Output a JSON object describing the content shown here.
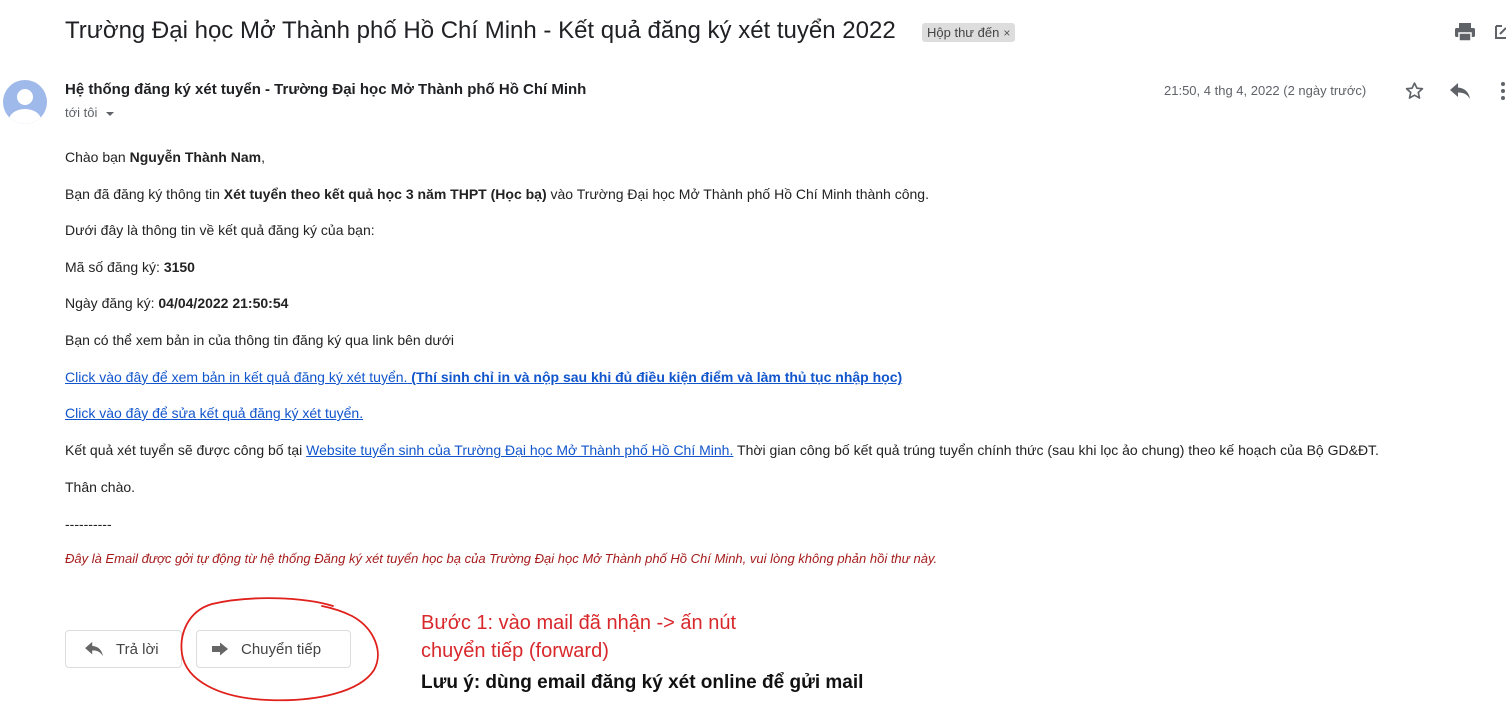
{
  "email": {
    "subject": "Trường Đại học Mở Thành phố Hồ Chí Minh - Kết quả đăng ký xét tuyển 2022",
    "label": "Hộp thư đến",
    "label_close": "×",
    "sender": "Hệ thống đăng ký xét tuyển - Trường Đại học Mở Thành phố Hồ Chí Minh",
    "to": "tới tôi",
    "date": "21:50, 4 thg 4, 2022 (2 ngày trước)"
  },
  "body": {
    "greeting_prefix": "Chào bạn ",
    "greeting_name": "Nguyễn Thành Nam",
    "greeting_suffix": ",",
    "line2_prefix": "Bạn đã đăng ký thông tin ",
    "line2_bold": "Xét tuyển theo kết quả học 3 năm THPT (Học bạ)",
    "line2_suffix": " vào Trường Đại học Mở Thành phố Hồ Chí Minh thành công.",
    "line3": "Dưới đây là thông tin về kết quả đăng ký của bạn:",
    "reg_no_label": "Mã số đăng ký: ",
    "reg_no_value": "3150",
    "reg_date_label": "Ngày đăng ký: ",
    "reg_date_value": "04/04/2022 21:50:54",
    "line6": "Bạn có thể xem bản in của thông tin đăng ký qua link bên dưới",
    "link1_text": "Click vào đây để xem bản in kết quả đăng ký xét tuyển.",
    "link1_bold": " (Thí sinh chỉ in và nộp sau khi đủ điều kiện điểm và làm thủ tục nhập học)",
    "link2_text": "Click vào đây để sửa kết quả đăng ký xét tuyển.",
    "line9_prefix": "Kết quả xét tuyển sẽ được công bố tại ",
    "line9_link": "Website tuyển sinh của Trường Đại học Mở Thành phố Hồ Chí Minh.",
    "line9_suffix": " Thời gian công bố kết quả trúng tuyển chính thức (sau khi lọc ảo chung) theo kế hoạch của Bộ GD&ĐT.",
    "closing": "Thân chào.",
    "separator": "----------",
    "notice": "Đây là Email được gởi tự động từ hệ thống Đăng ký xét tuyển học bạ của Trường Đại học Mở Thành phố Hồ Chí Minh, vui lòng không phản hồi thư này."
  },
  "actions": {
    "reply_label": "Trả lời",
    "forward_label": "Chuyển tiếp"
  },
  "annotation": {
    "step_line1": "Bước 1: vào mail đã nhận -> ấn nút",
    "step_line2": "chuyển tiếp (forward)",
    "note": "Lưu ý: dùng email đăng ký xét online để gửi mail",
    "color": "#d8282b"
  },
  "icons": [
    "print-icon",
    "new-window-icon",
    "star-icon",
    "reply-icon",
    "more-icon",
    "dropdown-icon",
    "avatar-icon",
    "forward-icon"
  ]
}
